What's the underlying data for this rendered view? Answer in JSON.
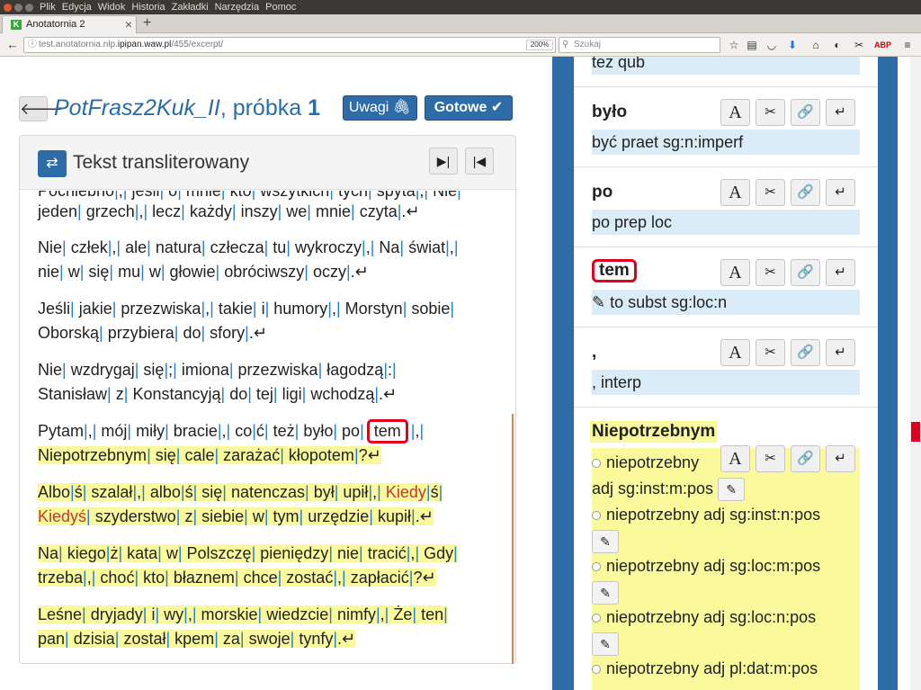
{
  "os_menu": {
    "items": [
      "Plik",
      "Edycja",
      "Widok",
      "Historia",
      "Zakładki",
      "Narzędzia",
      "Pomoc"
    ]
  },
  "browser": {
    "tab_title": "Anotatornia 2",
    "tab_favicon": "K",
    "url_prefix": "test.anotatornia.nlp.",
    "url_domain": "ipipan.waw.pl",
    "url_path": "/455/excerpt/",
    "zoom": "200%",
    "search_placeholder": "Szukaj"
  },
  "page": {
    "title_italic": "PotFrasz2Kuk_II",
    "title_rest": ", próbka ",
    "title_num": "1",
    "uwagi_label": "Uwagi",
    "gotowe_label": "Gotowe",
    "panel_title": "Tekst transliterowany"
  },
  "text_lines": {
    "l0": "Pochlebno|,| jeśli| o| mnie| kto| wszytkich| tych| spyta|,| Nie|",
    "l1": "jeden| grzech|,| lecz| każdy| inszy| we| mnie| czyta|.↵",
    "l2": "Nie| człek|,| ale| natura| człecza| tu| wykroczy|,| Na| świat|,|",
    "l3": "nie| w| się| mu| w| głowie| obróciwszy| oczy|.↵",
    "l4": "Jeśli| jakie| przezwiska|,| takie| i| humory|,| Morstyn| sobie|",
    "l5": "Oborską| przybiera| do| sfory|.↵",
    "l6": "Nie| wzdrygaj| się|;| imiona| przezwiska| łagodzą|:|",
    "l7": "Stanisław| z| Konstancyją| do| tej| ligi| wchodzą|.↵",
    "l8a": "Pytam|,| mój| miły| bracie|,| co|ć| też| było| po|",
    "l8_tem": "tem",
    "l8b": "|,|",
    "l9": "Niepotrzebnym| się| cale| zarażać| kłopotem|?↵",
    "l10": "Albo|ś| szalał|,| albo|ś| się| natenczas| był| upił|,| Kiedy|ś|",
    "l11": "Kiedyś| szyderstwo| z| siebie| w| tym| urzędzie| kupił|.↵",
    "l12": "Na| kiego|ż| kata| w| Polszczę| pieniędzy| nie| tracić|,| Gdy|",
    "l13": "trzeba|,| choć| kto| błaznem| chce| zostać|,| zapłacić|?↵",
    "l14": "Leśne| dryjady| i| wy|,| morskie| wiedzcie| nimfy|,| Że| ten|",
    "l15": "pan| dzisia| został| kpem| za| swoje| tynfy|.↵"
  },
  "sidebar": {
    "top_interp": "też qub",
    "entries": [
      {
        "orth": "było",
        "interp": "być praet sg:n:imperf"
      },
      {
        "orth": "po",
        "interp": "po prep loc"
      },
      {
        "orth": "tem",
        "interp": "to subst sg:loc:n"
      },
      {
        "orth": ",",
        "interp": ", interp"
      },
      {
        "orth": "Niepotrzebnym"
      }
    ],
    "candidates": [
      "niepotrzebny",
      "adj sg:inst:m:pos",
      "niepotrzebny adj sg:inst:n:pos",
      "niepotrzebny adj sg:loc:m:pos",
      "niepotrzebny adj sg:loc:n:pos",
      "niepotrzebny adj pl:dat:m:pos"
    ]
  },
  "colors": {
    "accent": "#2e6ca8",
    "highlight": "#fafa9c",
    "interp_bg": "#d9ecf8",
    "selected": "#e0001b"
  }
}
